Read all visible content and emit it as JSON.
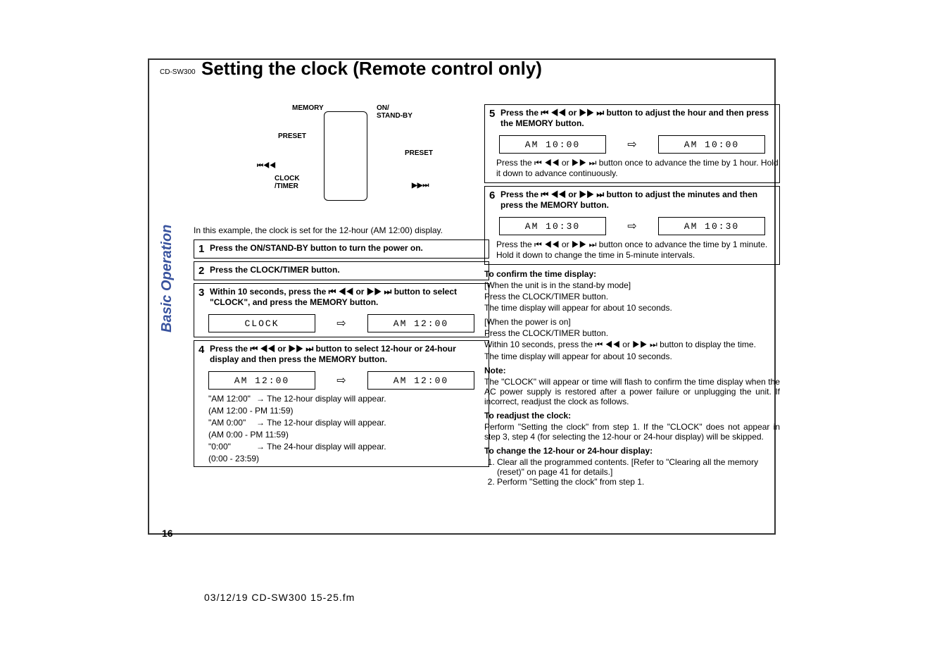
{
  "header": {
    "model": "CD-SW300",
    "title": "Setting the clock (Remote control only)"
  },
  "sideTab": "Basic Operation",
  "pageNumber": "16",
  "diagram": {
    "labels": {
      "memory": "MEMORY",
      "onStandby": "ON/\nSTAND-BY",
      "presetL": "PRESET",
      "presetR": "PRESET",
      "rewff": "⏮◀◀",
      "ffrew": "▶▶⏭",
      "clock": "CLOCK\n/TIMER"
    }
  },
  "exampleText": "In this example, the clock is set for the 12-hour (AM 12:00) display.",
  "steps": {
    "s1": {
      "num": "1",
      "text": "Press the ON/STAND-BY button to turn the power on."
    },
    "s2": {
      "num": "2",
      "text": "Press the CLOCK/TIMER button."
    },
    "s3": {
      "num": "3",
      "text": "Within 10 seconds, press the ⏮ ◀◀ or ▶▶ ⏭ button to select \"CLOCK\", and press the MEMORY button.",
      "lcdL": "CLOCK",
      "arrow": "⇨",
      "lcdR": "AM 12:00"
    },
    "s4": {
      "num": "4",
      "text": "Press the ⏮ ◀◀ or ▶▶ ⏭ button to select 12-hour or 24-hour display and then press the MEMORY button.",
      "bigLcdL": "AM 12:00",
      "arrow": "⇨",
      "bigLcdR": "AM 12:00",
      "rows": [
        {
          "code": "\"AM 12:00\"",
          "arrow": "→",
          "desc": "The 12-hour display will appear.",
          "sub": "(AM 12:00 - PM 11:59)"
        },
        {
          "code": "\"AM 0:00\"",
          "arrow": "→",
          "desc": "The 12-hour display will appear.",
          "sub": "(AM 0:00 - PM 11:59)"
        },
        {
          "code": "\"0:00\"",
          "arrow": "→",
          "desc": "The 24-hour display will appear.",
          "sub": "(0:00 - 23:59)"
        }
      ]
    },
    "s5": {
      "num": "5",
      "text": "Press the ⏮ ◀◀ or ▶▶ ⏭ button to adjust the hour and then press the MEMORY button.",
      "lcdL": "AM 10:00",
      "arrow": "⇨",
      "lcdR": "AM 10:00",
      "press": "Press the ⏮ ◀◀ or ▶▶ ⏭ button once to advance the time by 1 hour. Hold it down to advance continuously."
    },
    "s6": {
      "num": "6",
      "text": "Press the ⏮ ◀◀ or ▶▶ ⏭ button to adjust the minutes and then press the MEMORY button.",
      "lcdL": "AM 10:30",
      "arrow": "⇨",
      "lcdR": "AM 10:30",
      "press": "Press the ⏮ ◀◀ or ▶▶ ⏭ button once to advance the time by 1 minute. Hold it down to change the time in 5-minute intervals."
    }
  },
  "notes": {
    "confirm": {
      "hdr": "To confirm the time display:",
      "l1": "[When the unit is in the stand-by mode]",
      "l2": "Press the CLOCK/TIMER button.",
      "l3": "The time display will appear for about 10 seconds.",
      "l4": "[When the power is on]",
      "l5": "Press the CLOCK/TIMER button.",
      "l6": "Within 10 seconds, press the ⏮ ◀◀ or ▶▶ ⏭ button to display the time.",
      "l7": "The time display will appear for about 10 seconds."
    },
    "note": {
      "hdr": "Note:",
      "p": "The \"CLOCK\" will appear or time will flash to confirm the time display when the AC power supply is restored after a power failure or unplugging the unit. If incorrect, readjust the clock as follows."
    },
    "readjust": {
      "hdr": "To readjust the clock:",
      "p": "Perform \"Setting the clock\" from step 1. If the \"CLOCK\" does not appear in step 3, step 4 (for selecting the 12-hour or 24-hour display) will be skipped."
    },
    "change": {
      "hdr": "To change the 12-hour or 24-hour display:",
      "li1": "Clear all the programmed contents. [Refer to \"Clearing all the memory (reset)\" on page 41 for details.]",
      "li2": "Perform \"Setting the clock\" from step 1."
    }
  },
  "footer": "03/12/19    CD-SW300 15-25.fm"
}
